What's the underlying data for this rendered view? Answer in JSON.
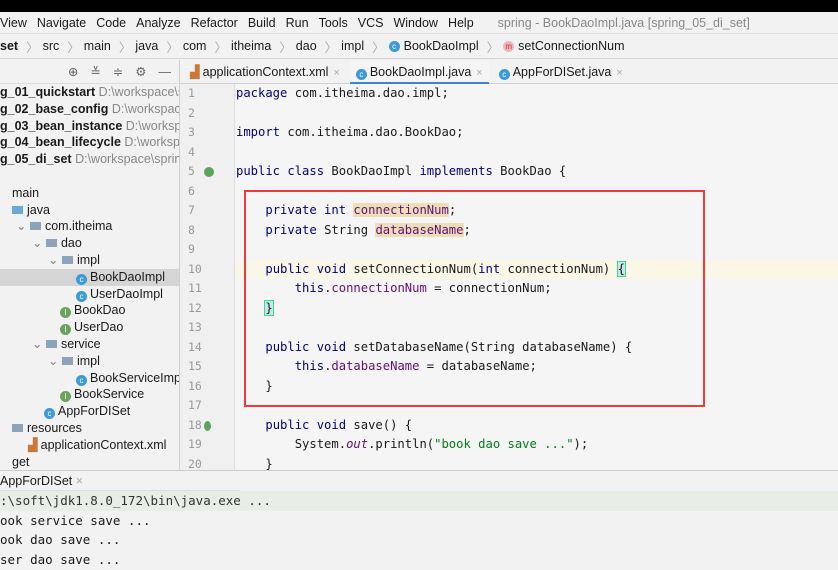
{
  "menu": [
    "View",
    "Navigate",
    "Code",
    "Analyze",
    "Refactor",
    "Build",
    "Run",
    "Tools",
    "VCS",
    "Window",
    "Help"
  ],
  "window_title": "spring - BookDaoImpl.java [spring_05_di_set]",
  "breadcrumb": [
    "set",
    "src",
    "main",
    "java",
    "com",
    "itheima",
    "dao",
    "impl",
    "BookDaoImpl",
    "setConnectionNum"
  ],
  "projects": [
    {
      "name": "g_01_quickstart",
      "path": "D:\\workspace\\spri"
    },
    {
      "name": "g_02_base_config",
      "path": "D:\\workspace\\sp"
    },
    {
      "name": "g_03_bean_instance",
      "path": "D:\\workspace\\"
    },
    {
      "name": "g_04_bean_lifecycle",
      "path": "D:\\workspace\\"
    },
    {
      "name": "g_05_di_set",
      "path": "D:\\workspace\\spring\\s"
    }
  ],
  "tree": [
    {
      "label": "main",
      "indent": 0,
      "icon": "none"
    },
    {
      "label": "java",
      "indent": 0,
      "icon": "folder-blue"
    },
    {
      "label": "com.itheima",
      "indent": 1,
      "icon": "package",
      "arrow": true
    },
    {
      "label": "dao",
      "indent": 2,
      "icon": "package",
      "arrow": true
    },
    {
      "label": "impl",
      "indent": 3,
      "icon": "package",
      "arrow": true
    },
    {
      "label": "BookDaoImpl",
      "indent": 4,
      "icon": "class",
      "selected": true
    },
    {
      "label": "UserDaoImpl",
      "indent": 4,
      "icon": "class"
    },
    {
      "label": "BookDao",
      "indent": 3,
      "icon": "interface"
    },
    {
      "label": "UserDao",
      "indent": 3,
      "icon": "interface"
    },
    {
      "label": "service",
      "indent": 2,
      "icon": "package",
      "arrow": true
    },
    {
      "label": "impl",
      "indent": 3,
      "icon": "package",
      "arrow": true
    },
    {
      "label": "BookServiceImpl",
      "indent": 4,
      "icon": "class"
    },
    {
      "label": "BookService",
      "indent": 3,
      "icon": "interface"
    },
    {
      "label": "AppForDISet",
      "indent": 2,
      "icon": "class-main"
    },
    {
      "label": "resources",
      "indent": 0,
      "icon": "folder-res"
    },
    {
      "label": "applicationContext.xml",
      "indent": 1,
      "icon": "xml"
    },
    {
      "label": "get",
      "indent": 0,
      "icon": "none"
    }
  ],
  "tabs": [
    {
      "label": "applicationContext.xml",
      "icon": "xml"
    },
    {
      "label": "BookDaoImpl.java",
      "icon": "class",
      "active": true
    },
    {
      "label": "AppForDISet.java",
      "icon": "class-main"
    }
  ],
  "code": [
    [
      [
        "k",
        "package "
      ],
      [
        "",
        "com.itheima.dao.impl;"
      ]
    ],
    [],
    [
      [
        "k",
        "import "
      ],
      [
        "",
        "com.itheima.dao.BookDao;"
      ]
    ],
    [],
    [
      [
        "k",
        "public class "
      ],
      [
        "",
        "BookDaoImpl "
      ],
      [
        "k",
        "implements "
      ],
      [
        "",
        "BookDao {"
      ]
    ],
    [],
    [
      [
        "",
        "    "
      ],
      [
        "k",
        "private int "
      ],
      [
        "f hl",
        "connectionNum"
      ],
      [
        "",
        ";"
      ]
    ],
    [
      [
        "",
        "    "
      ],
      [
        "k",
        "private "
      ],
      [
        "",
        "String "
      ],
      [
        "f hl",
        "databaseName"
      ],
      [
        "",
        ";"
      ]
    ],
    [],
    [
      [
        "",
        "    "
      ],
      [
        "k",
        "public void "
      ],
      [
        "",
        "setConnectionNum("
      ],
      [
        "k",
        "int "
      ],
      [
        "",
        "connectionNum) "
      ],
      [
        "br",
        "{"
      ]
    ],
    [
      [
        "",
        "        "
      ],
      [
        "k",
        "this"
      ],
      [
        "",
        "."
      ],
      [
        "f",
        "connectionNum"
      ],
      [
        "",
        " = connectionNum;"
      ]
    ],
    [
      [
        "",
        "    "
      ],
      [
        "br",
        "}"
      ]
    ],
    [],
    [
      [
        "",
        "    "
      ],
      [
        "k",
        "public void "
      ],
      [
        "",
        "setDatabaseName(String databaseName) {"
      ]
    ],
    [
      [
        "",
        "        "
      ],
      [
        "k",
        "this"
      ],
      [
        "",
        "."
      ],
      [
        "f",
        "databaseName"
      ],
      [
        "",
        " = databaseName;"
      ]
    ],
    [
      [
        "",
        "    }"
      ]
    ],
    [],
    [
      [
        "",
        "    "
      ],
      [
        "k",
        "public void "
      ],
      [
        "",
        "save() {"
      ]
    ],
    [
      [
        "",
        "        System."
      ],
      [
        "it",
        "out"
      ],
      [
        "",
        ".println("
      ],
      [
        "s",
        "\"book dao save ...\""
      ],
      [
        "",
        ");"
      ]
    ],
    [
      [
        "",
        "    }"
      ]
    ]
  ],
  "run_tab": "AppForDISet",
  "console": [
    ":\\soft\\jdk1.8.0_172\\bin\\java.exe ...",
    "ook service save ...",
    "ook dao save ...",
    "ser dao save ..."
  ]
}
